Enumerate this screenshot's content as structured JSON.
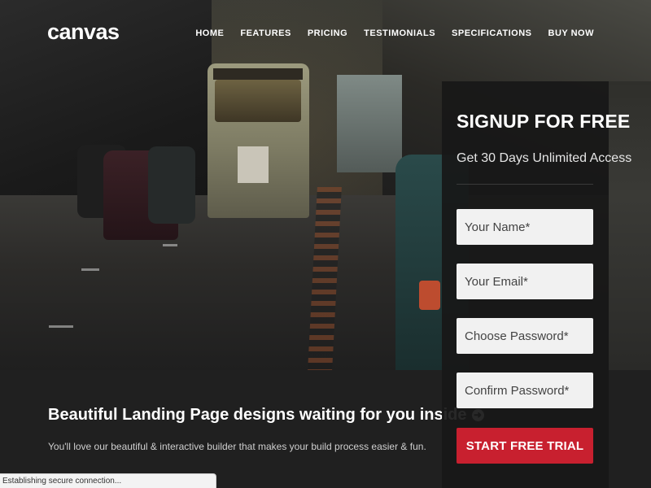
{
  "brand": {
    "logo_text": "canvas"
  },
  "nav": {
    "items": [
      {
        "label": "HOME"
      },
      {
        "label": "FEATURES"
      },
      {
        "label": "PRICING"
      },
      {
        "label": "TESTIMONIALS"
      },
      {
        "label": "SPECIFICATIONS"
      },
      {
        "label": "BUY NOW"
      }
    ]
  },
  "signup": {
    "title": "SIGNUP FOR FREE",
    "subtitle": "Get 30 Days Unlimited Access",
    "fields": {
      "name_placeholder": "Your Name*",
      "email_placeholder": "Your Email*",
      "password_placeholder": "Choose Password*",
      "confirm_placeholder": "Confirm Password*"
    },
    "cta_label": "START FREE TRIAL"
  },
  "promo": {
    "heading": "Beautiful Landing Page designs waiting for you inside",
    "subtext": "You'll love our beautiful & interactive builder that makes your build process easier & fun."
  },
  "status_bar": {
    "text": "Establishing secure connection..."
  },
  "colors": {
    "accent": "#c8202f",
    "panel_bg": "#181818",
    "page_bg": "#202020"
  }
}
